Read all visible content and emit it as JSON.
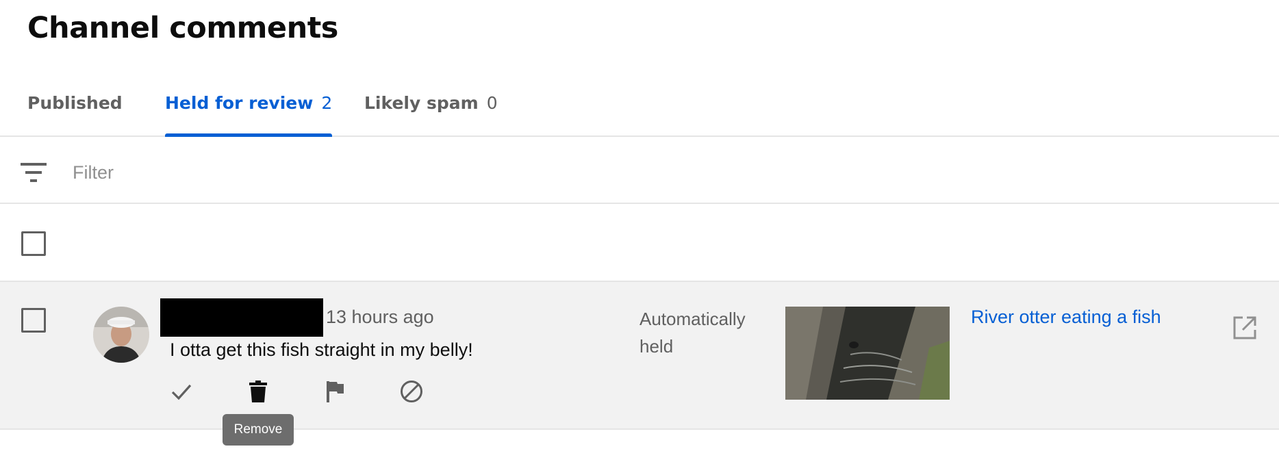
{
  "page": {
    "title": "Channel comments"
  },
  "tabs": [
    {
      "label": "Published",
      "count": ""
    },
    {
      "label": "Held for review",
      "count": "2"
    },
    {
      "label": "Likely spam",
      "count": "0"
    }
  ],
  "active_tab": "Held for review",
  "filter": {
    "placeholder": "Filter",
    "value": "",
    "icon": "filter-icon"
  },
  "comments": [
    {
      "author": "",
      "timestamp": "13 hours ago",
      "text": "I otta get this fish straight in my belly!",
      "status": "Automatically held",
      "video_title": "River otter eating a fish",
      "actions": [
        "approve-icon",
        "remove-icon",
        "report-icon",
        "hide-user-icon"
      ]
    }
  ],
  "tooltip": {
    "label": "Remove"
  },
  "colors": {
    "accent": "#065fd4",
    "row_bg": "#f2f2f2",
    "muted_text": "#606060",
    "tooltip_bg": "#6d6d6d"
  }
}
